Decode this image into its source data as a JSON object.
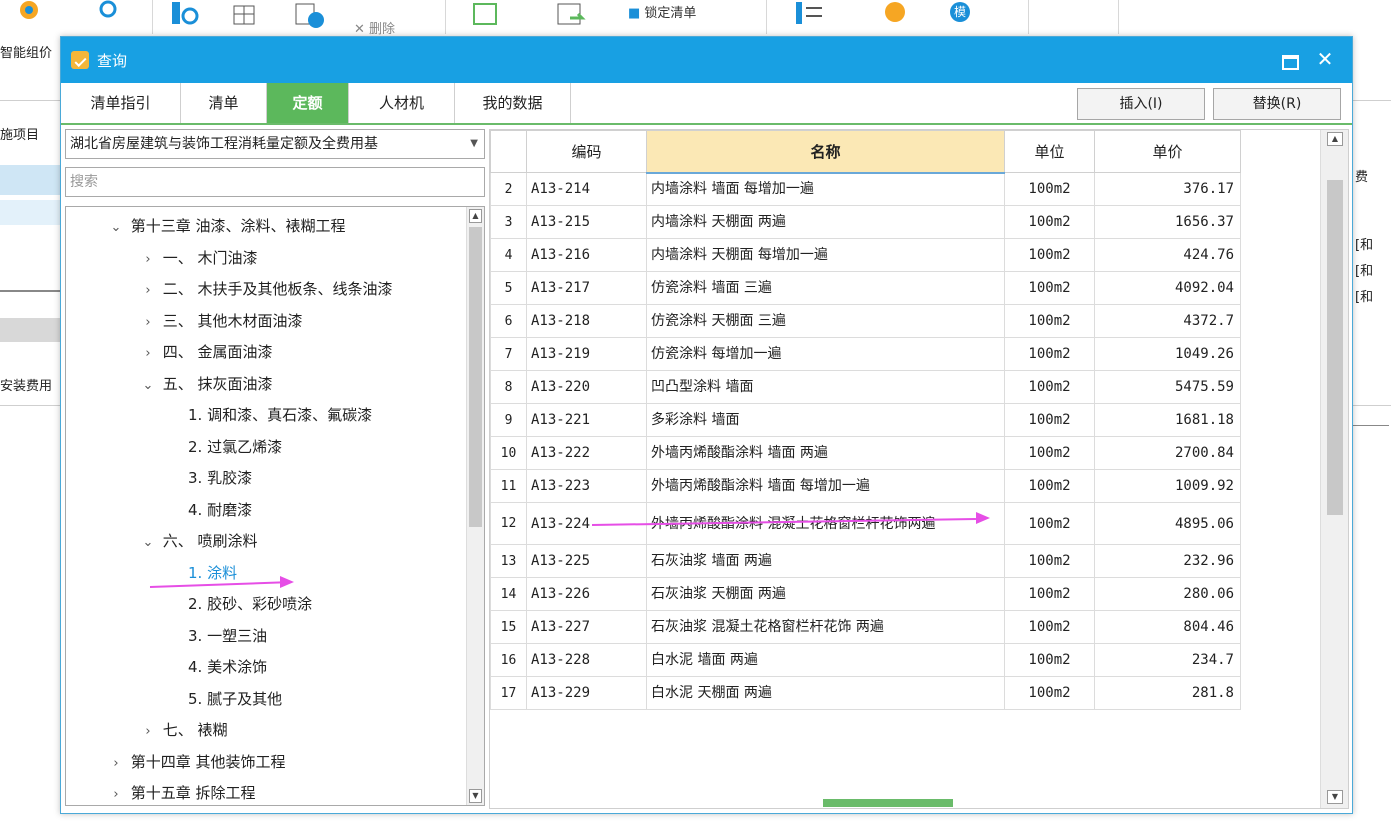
{
  "toolbar": {
    "delete_label": "删除",
    "lock_label": "锁定清单",
    "mo_label": "模"
  },
  "background": {
    "left_label_1": "智能组价",
    "left_label_2": "施项目",
    "left_label_3": "安装费用",
    "right_label_1": "费",
    "right_label_2": "[和",
    "right_label_3": "[和",
    "right_label_4": "[和"
  },
  "dialog": {
    "title": "查询",
    "tabs": [
      {
        "label": "清单指引",
        "active": false
      },
      {
        "label": "清单",
        "active": false
      },
      {
        "label": "定额",
        "active": true
      },
      {
        "label": "人材机",
        "active": false
      },
      {
        "label": "我的数据",
        "active": false
      }
    ],
    "insert_button": "插入(I)",
    "replace_button": "替换(R)"
  },
  "left_panel": {
    "library_select": "湖北省房屋建筑与装饰工程消耗量定额及全费用基",
    "search_placeholder": "搜索",
    "tree": [
      {
        "label": "第十三章 油漆、涂料、裱糊工程",
        "level": 0,
        "state": "expanded"
      },
      {
        "label": "一、 木门油漆",
        "level": 1,
        "state": "collapsed"
      },
      {
        "label": "二、 木扶手及其他板条、线条油漆",
        "level": 1,
        "state": "collapsed"
      },
      {
        "label": "三、 其他木材面油漆",
        "level": 1,
        "state": "collapsed"
      },
      {
        "label": "四、 金属面油漆",
        "level": 1,
        "state": "collapsed"
      },
      {
        "label": "五、 抹灰面油漆",
        "level": 1,
        "state": "expanded"
      },
      {
        "label": "1. 调和漆、真石漆、氟碳漆",
        "level": 2,
        "state": "leaf"
      },
      {
        "label": "2. 过氯乙烯漆",
        "level": 2,
        "state": "leaf"
      },
      {
        "label": "3. 乳胶漆",
        "level": 2,
        "state": "leaf"
      },
      {
        "label": "4. 耐磨漆",
        "level": 2,
        "state": "leaf"
      },
      {
        "label": "六、 喷刷涂料",
        "level": 1,
        "state": "expanded"
      },
      {
        "label": "1. 涂料",
        "level": 2,
        "state": "selected"
      },
      {
        "label": "2. 胶砂、彩砂喷涂",
        "level": 2,
        "state": "leaf"
      },
      {
        "label": "3. 一塑三油",
        "level": 2,
        "state": "leaf"
      },
      {
        "label": "4. 美术涂饰",
        "level": 2,
        "state": "leaf"
      },
      {
        "label": "5. 腻子及其他",
        "level": 2,
        "state": "leaf"
      },
      {
        "label": "七、 裱糊",
        "level": 1,
        "state": "collapsed"
      },
      {
        "label": "第十四章 其他装饰工程",
        "level": 0,
        "state": "collapsed"
      },
      {
        "label": "第十五章 拆除工程",
        "level": 0,
        "state": "collapsed"
      }
    ]
  },
  "grid": {
    "columns": [
      "",
      "编码",
      "名称",
      "单位",
      "单价"
    ],
    "rows": [
      {
        "n": "2",
        "code": "A13-214",
        "name": "内墙涂料 墙面 每增加一遍",
        "unit": "100m2",
        "price": "376.17"
      },
      {
        "n": "3",
        "code": "A13-215",
        "name": "内墙涂料 天棚面 两遍",
        "unit": "100m2",
        "price": "1656.37"
      },
      {
        "n": "4",
        "code": "A13-216",
        "name": "内墙涂料 天棚面 每增加一遍",
        "unit": "100m2",
        "price": "424.76"
      },
      {
        "n": "5",
        "code": "A13-217",
        "name": "仿瓷涂料 墙面 三遍",
        "unit": "100m2",
        "price": "4092.04"
      },
      {
        "n": "6",
        "code": "A13-218",
        "name": "仿瓷涂料 天棚面 三遍",
        "unit": "100m2",
        "price": "4372.7"
      },
      {
        "n": "7",
        "code": "A13-219",
        "name": "仿瓷涂料 每增加一遍",
        "unit": "100m2",
        "price": "1049.26"
      },
      {
        "n": "8",
        "code": "A13-220",
        "name": "凹凸型涂料 墙面",
        "unit": "100m2",
        "price": "5475.59"
      },
      {
        "n": "9",
        "code": "A13-221",
        "name": "多彩涂料 墙面",
        "unit": "100m2",
        "price": "1681.18"
      },
      {
        "n": "10",
        "code": "A13-222",
        "name": "外墙丙烯酸酯涂料 墙面 两遍",
        "unit": "100m2",
        "price": "2700.84"
      },
      {
        "n": "11",
        "code": "A13-223",
        "name": "外墙丙烯酸酯涂料 墙面 每增加一遍",
        "unit": "100m2",
        "price": "1009.92"
      },
      {
        "n": "12",
        "code": "A13-224",
        "name": "外墙丙烯酸酯涂料 混凝土花格窗栏杆花饰两遍",
        "unit": "100m2",
        "price": "4895.06"
      },
      {
        "n": "13",
        "code": "A13-225",
        "name": "石灰油浆 墙面 两遍",
        "unit": "100m2",
        "price": "232.96"
      },
      {
        "n": "14",
        "code": "A13-226",
        "name": "石灰油浆 天棚面 两遍",
        "unit": "100m2",
        "price": "280.06"
      },
      {
        "n": "15",
        "code": "A13-227",
        "name": "石灰油浆 混凝土花格窗栏杆花饰 两遍",
        "unit": "100m2",
        "price": "804.46"
      },
      {
        "n": "16",
        "code": "A13-228",
        "name": "白水泥 墙面 两遍",
        "unit": "100m2",
        "price": "234.7"
      },
      {
        "n": "17",
        "code": "A13-229",
        "name": "白水泥 天棚面 两遍",
        "unit": "100m2",
        "price": "281.8"
      }
    ]
  },
  "colors": {
    "titlebar": "#18a0e3",
    "active_tab": "#5cb85c",
    "header_highlight": "#fbe8b5",
    "annotation_arrow": "#e64ee6",
    "selected_tree": "#1a8fd8"
  }
}
